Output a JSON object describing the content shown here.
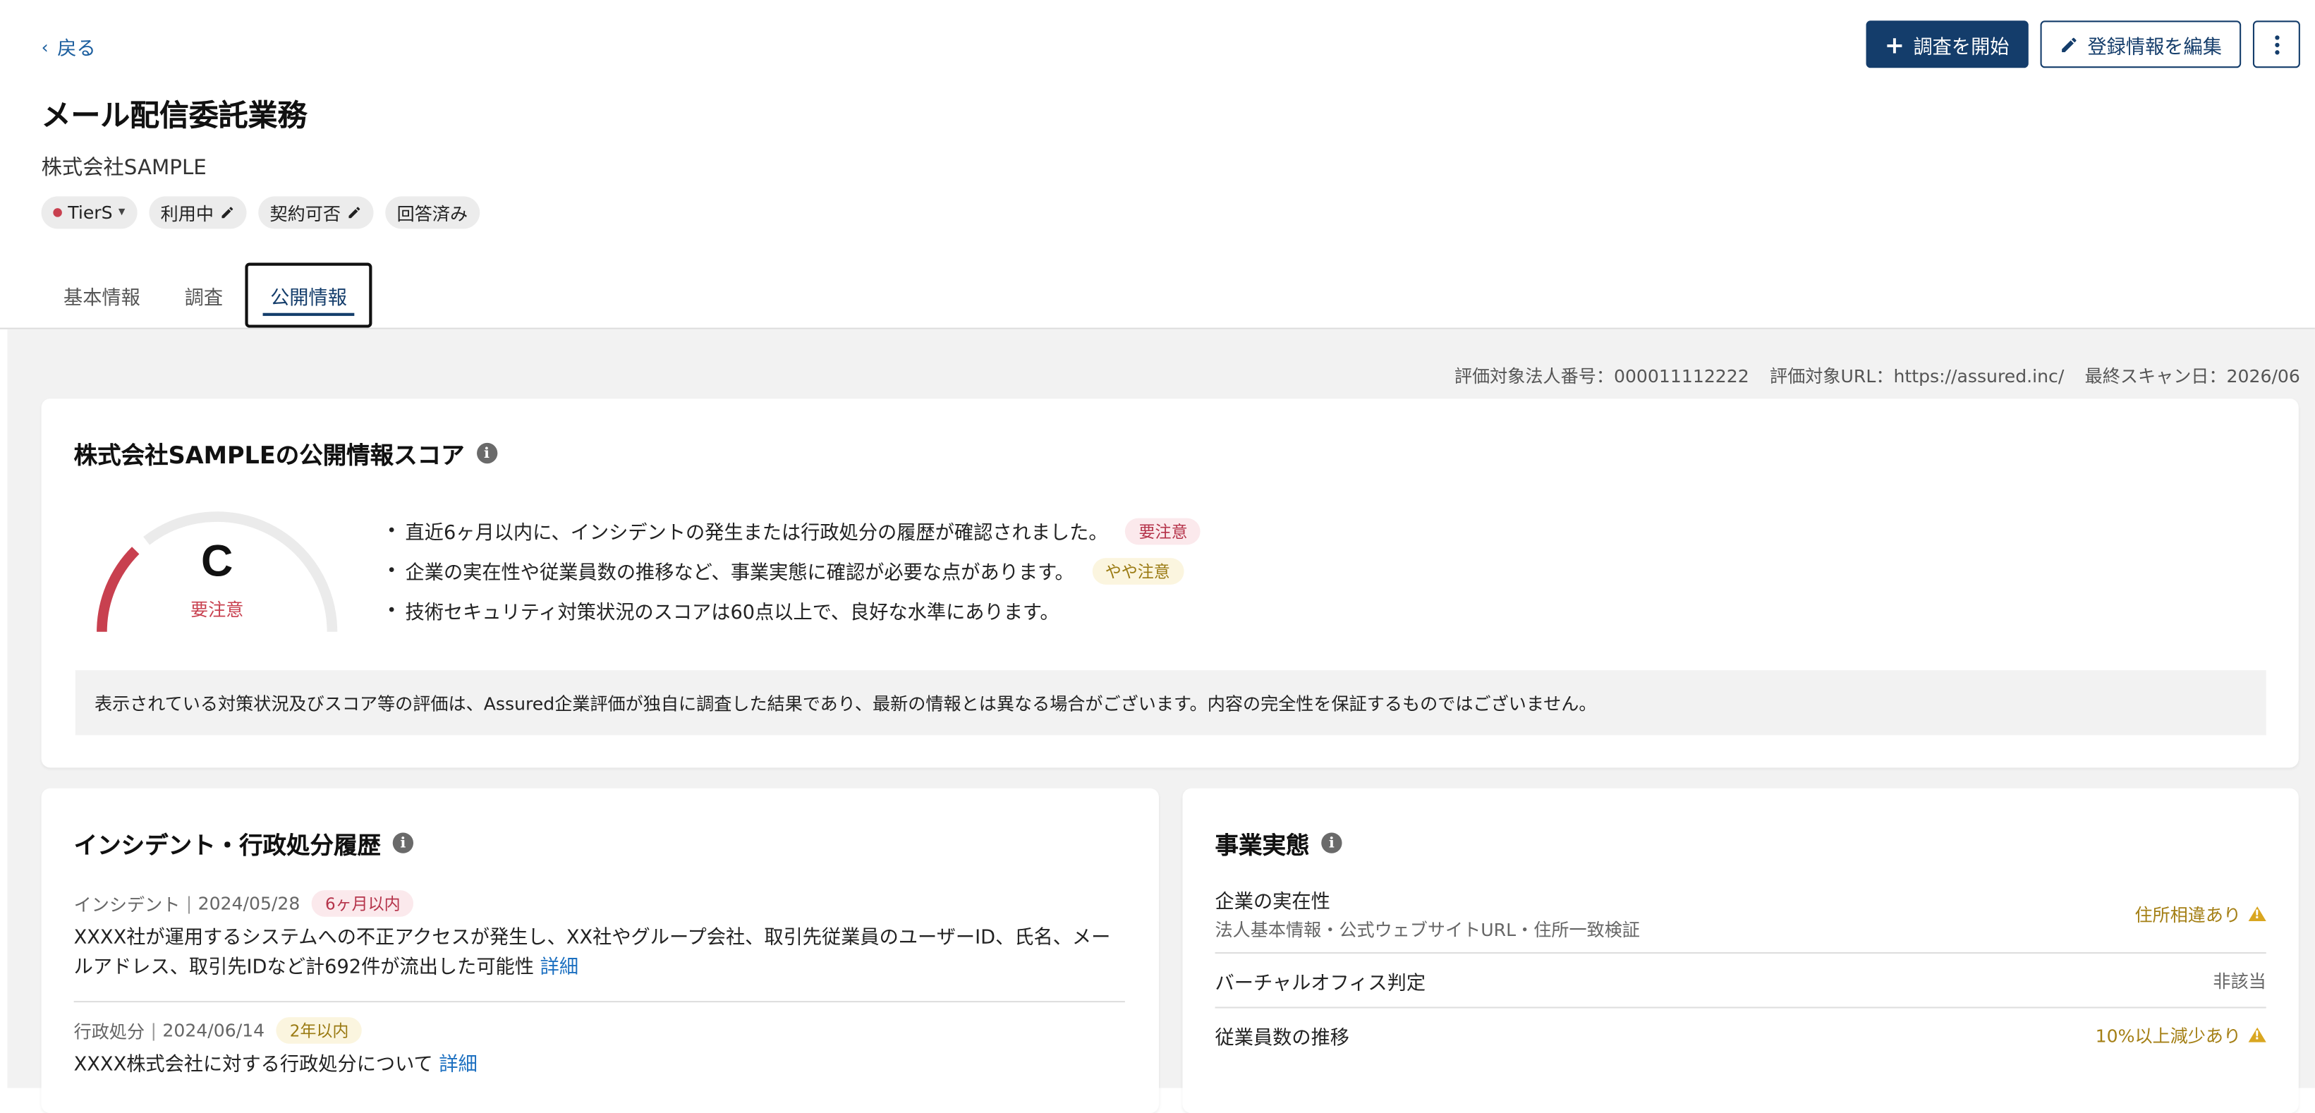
{
  "nav": {
    "back_label": "戻る"
  },
  "actions": {
    "start_survey": "調査を開始",
    "edit_registration": "登録情報を編集"
  },
  "header": {
    "title": "メール配信委託業務",
    "company": "株式会社SAMPLE",
    "chips": [
      "TierS",
      "利用中",
      "契約可否",
      "回答済み"
    ]
  },
  "tabs": [
    "基本情報",
    "調査",
    "公開情報"
  ],
  "meta": {
    "corp_number": "評価対象法人番号：000011112222",
    "target_url": "評価対象URL：https://assured.inc/",
    "last_scan": "最終スキャン日：2026/06"
  },
  "score": {
    "title": "株式会社SAMPLEの公開情報スコア",
    "grade": "C",
    "grade_label": "要注意",
    "gauge_fraction": 0.25,
    "colors": {
      "gauge_fill": "#c8404f",
      "gauge_track": "#ebebeb"
    },
    "bullets": [
      {
        "text": "直近6ヶ月以内に、インシデントの発生または行政処分の履歴が確認されました。",
        "tag": "要注意"
      },
      {
        "text": "企業の実在性や従業員数の推移など、事業実態に確認が必要な点があります。",
        "tag": "やや注意"
      },
      {
        "text": "技術セキュリティ対策状況のスコアは60点以上で、良好な水準にあります。",
        "tag": ""
      }
    ],
    "disclaimer": "表示されている対策状況及びスコア等の評価は、Assured企業評価が独自に調査した結果であり、最新の情報とは異なる場合がございます。内容の完全性を保証するものではございません。"
  },
  "incidents": {
    "title": "インシデント・行政処分履歴",
    "items": [
      {
        "type": "インシデント",
        "date": "2024/05/28",
        "badge": "6ヶ月以内",
        "body": "XXXX社が運用するシステムへの不正アクセスが発生し、XX社やグループ会社、取引先従業員のユーザーID、氏名、メールアドレス、取引先IDなど計692件が流出した可能性",
        "link": "詳細"
      },
      {
        "type": "行政処分",
        "date": "2024/06/14",
        "badge": "2年以内",
        "body": "XXXX株式会社に対する行政処分について",
        "link": "詳細"
      }
    ]
  },
  "business": {
    "title": "事業実態",
    "rows": [
      {
        "label": "企業の実在性",
        "sub": "法人基本情報・公式ウェブサイトURL・住所一致検証",
        "value": "住所相違あり",
        "status": "warn"
      },
      {
        "label": "バーチャルオフィス判定",
        "sub": "",
        "value": "非該当",
        "status": "ok"
      },
      {
        "label": "従業員数の推移",
        "sub": "",
        "value": "10%以上減少あり",
        "status": "warn"
      }
    ]
  }
}
